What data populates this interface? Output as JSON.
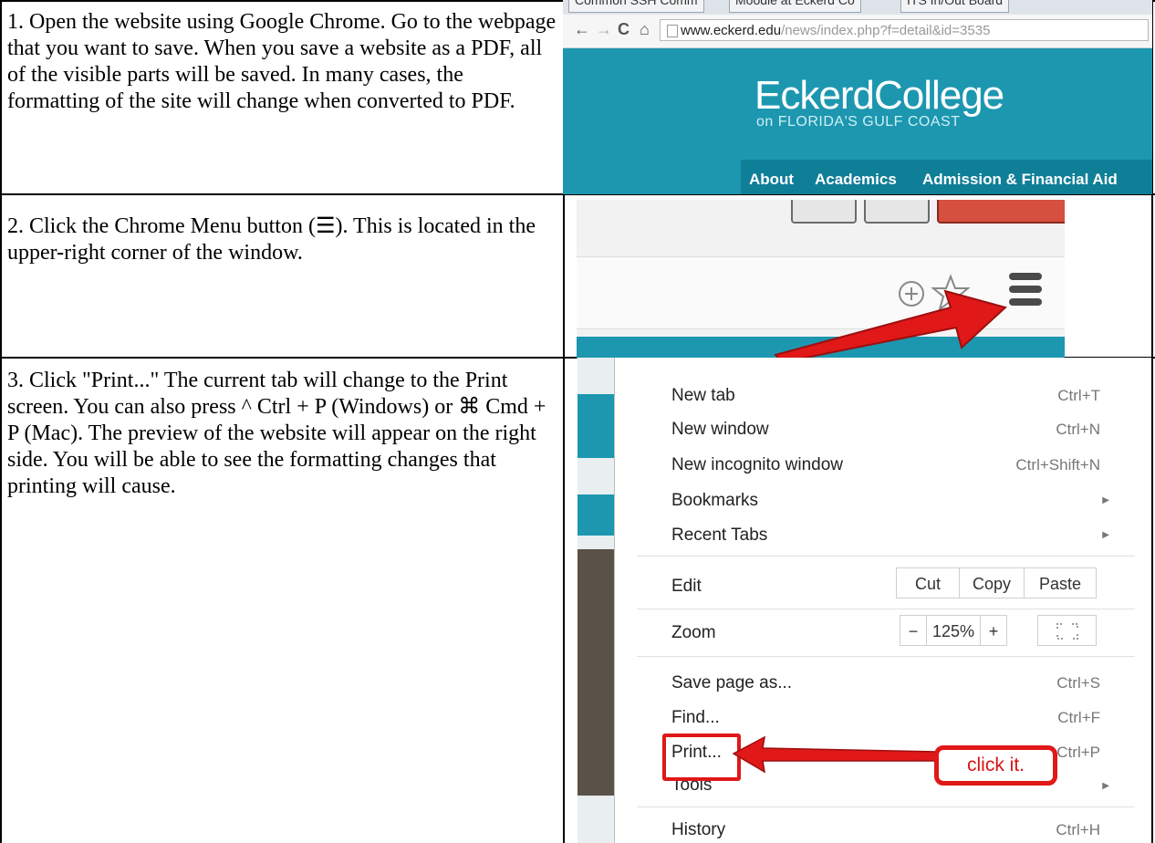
{
  "steps": [
    {
      "text": "1. Open the website using Google Chrome. Go to the webpage that you want to save. When you save a website as a PDF, all of the visible parts will be saved. In many cases, the formatting of the site will change when converted to PDF."
    },
    {
      "text": "2. Click the Chrome Menu button (☰). This is located in the upper-right corner of the window."
    },
    {
      "text": "3. Click \"Print...\" The current tab will change to the Print screen. You can also press ^ Ctrl + P (Windows) or ⌘ Cmd + P (Mac). The preview of the website will appear on the right side. You will be able to see the formatting changes that printing will cause."
    }
  ],
  "browser": {
    "tabs": [
      "Common SSH Comm",
      "Moodle at Eckerd Co",
      "ITS In/Out Board"
    ],
    "url_domain": "www.eckerd.edu",
    "url_path": "/news/index.php?f=detail&id=3535"
  },
  "site": {
    "logo": "EckerdCollege",
    "tagline": "on FLORIDA'S GULF COAST",
    "nav": [
      "About",
      "Academics",
      "Admission & Financial Aid"
    ]
  },
  "chrome_menu": {
    "items": [
      {
        "label": "New tab",
        "shortcut": "Ctrl+T"
      },
      {
        "label": "New window",
        "shortcut": "Ctrl+N"
      },
      {
        "label": "New incognito window",
        "shortcut": "Ctrl+Shift+N"
      },
      {
        "label": "Bookmarks",
        "shortcut": ""
      },
      {
        "label": "Recent Tabs",
        "shortcut": ""
      },
      {
        "label": "Edit",
        "shortcut": ""
      },
      {
        "label": "Zoom",
        "shortcut": ""
      },
      {
        "label": "Save page as...",
        "shortcut": "Ctrl+S"
      },
      {
        "label": "Find...",
        "shortcut": "Ctrl+F"
      },
      {
        "label": "Print...",
        "shortcut": "Ctrl+P"
      },
      {
        "label": "Tools",
        "shortcut": ""
      },
      {
        "label": "History",
        "shortcut": "Ctrl+H"
      }
    ],
    "edit_buttons": [
      "Cut",
      "Copy",
      "Paste"
    ],
    "zoom_minus": "−",
    "zoom_value": "125%",
    "zoom_plus": "+",
    "callout": "click it."
  },
  "colors": {
    "eckerd_teal": "#1d97b0",
    "highlight_red": "#e01818"
  },
  "icons": [
    "back-arrow-icon",
    "forward-arrow-icon",
    "reload-icon",
    "home-icon",
    "page-icon",
    "zoom-plus-icon",
    "star-icon",
    "hamburger-menu-icon",
    "submenu-arrow-icon",
    "fullscreen-icon"
  ]
}
